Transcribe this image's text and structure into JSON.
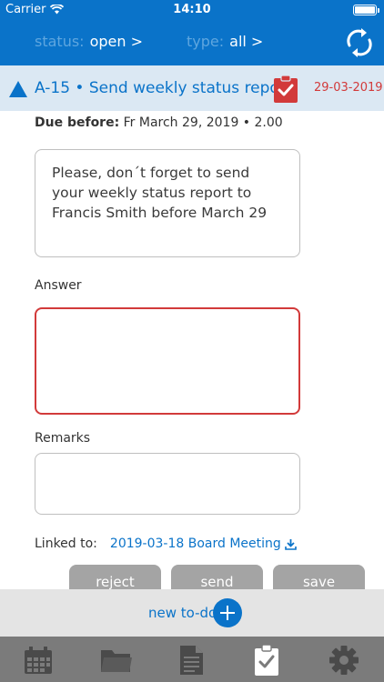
{
  "statusbar": {
    "carrier": "Carrier",
    "time": "14:10"
  },
  "filters": {
    "status_key": "status:",
    "status_value": "open >",
    "type_key": "type:",
    "type_value": "all >"
  },
  "task": {
    "title": "A-15 • Send weekly status report",
    "date": "29-03-2019",
    "due_label": "Due before:",
    "due_value": "Fr March 29, 2019 • 2.00",
    "description": "Please, don´t forget to send your weekly status report to Francis Smith before March 29"
  },
  "form": {
    "answer_label": "Answer",
    "answer_value": "",
    "remarks_label": "Remarks",
    "remarks_value": "",
    "linked_label": "Linked to:",
    "linked_value": "2019-03-18 Board Meeting"
  },
  "buttons": {
    "reject": "reject",
    "send": "send",
    "save": "save"
  },
  "new_todo": {
    "label": "new to-do"
  },
  "colors": {
    "brand": "#0a73c9",
    "alert": "#d23a3a",
    "tabbar": "#7b7b7b"
  },
  "tabs": [
    "calendar-icon",
    "folder-icon",
    "document-icon",
    "clipboard-check-icon",
    "gear-icon"
  ]
}
